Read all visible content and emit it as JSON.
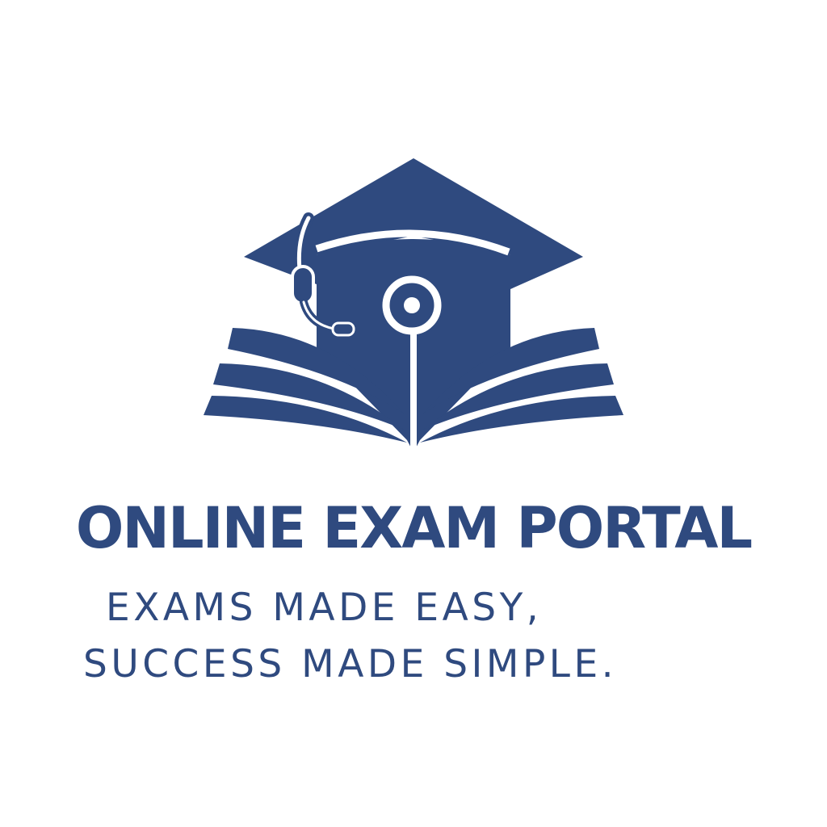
{
  "logo": {
    "icon": "graduation-cap-book-headset-icon",
    "brand_color": "#2f4a7f",
    "background": "#ffffff"
  },
  "brand": {
    "name": "ONLINE EXAM PORTAL"
  },
  "tagline": {
    "line1": "EXAMS MADE EASY,",
    "line2": "SUCCESS MADE SIMPLE."
  }
}
